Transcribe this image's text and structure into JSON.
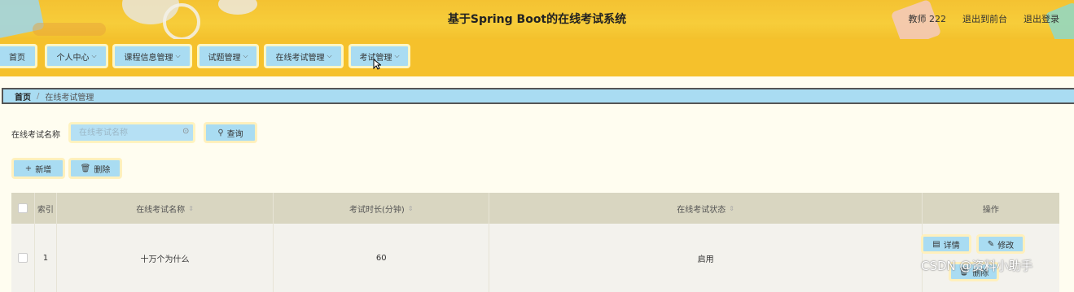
{
  "header": {
    "title": "基于Spring Boot的在线考试系统",
    "user_label": "教师 222",
    "back_to_front": "退出到前台",
    "logout": "退出登录"
  },
  "nav": {
    "items": [
      {
        "label": "首页",
        "has_dropdown": false
      },
      {
        "label": "个人中心",
        "has_dropdown": true
      },
      {
        "label": "课程信息管理",
        "has_dropdown": true
      },
      {
        "label": "试题管理",
        "has_dropdown": true
      },
      {
        "label": "在线考试管理",
        "has_dropdown": true
      },
      {
        "label": "考试管理",
        "has_dropdown": true
      }
    ]
  },
  "breadcrumb": {
    "home": "首页",
    "separator": "/",
    "current": "在线考试管理"
  },
  "search": {
    "label": "在线考试名称",
    "placeholder": "在线考试名称",
    "query_button": "查询"
  },
  "toolbar": {
    "add_button": "新增",
    "delete_button": "删除"
  },
  "table": {
    "columns": [
      "",
      "索引",
      "在线考试名称",
      "考试时长(分钟)",
      "在线考试状态",
      "操作"
    ],
    "rows": [
      {
        "index": "1",
        "name": "十万个为什么",
        "duration": "60",
        "status": "启用"
      }
    ],
    "row_actions": {
      "detail": "详情",
      "edit": "修改",
      "delete": "删除"
    }
  },
  "watermark": "CSDN @资料小助手",
  "colors": {
    "header_bg": "#f4c232",
    "nav_bg": "#f5c12c",
    "button_bg": "#a9dcf2",
    "button_border": "#fff0bd",
    "page_bg": "#fffdf0",
    "table_header_bg": "#d9d6c1"
  }
}
